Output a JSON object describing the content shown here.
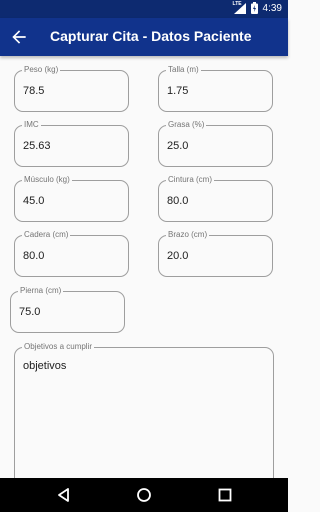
{
  "status": {
    "network": "LTE",
    "time": "4:39"
  },
  "appbar": {
    "title": "Capturar Cita - Datos Paciente",
    "back_icon": "arrow-left-icon"
  },
  "fields": {
    "peso": {
      "label": "Peso (kg)",
      "value": "78.5"
    },
    "talla": {
      "label": "Talla (m)",
      "value": "1.75"
    },
    "imc": {
      "label": "IMC",
      "value": "25.63"
    },
    "grasa": {
      "label": "Grasa (%)",
      "value": "25.0"
    },
    "musculo": {
      "label": "Músculo (kg)",
      "value": "45.0"
    },
    "cintura": {
      "label": "Cintura (cm)",
      "value": "80.0"
    },
    "cadera": {
      "label": "Cadera (cm)",
      "value": "80.0"
    },
    "brazo": {
      "label": "Brazo (cm)",
      "value": "20.0"
    },
    "pierna": {
      "label": "Pierna (cm)",
      "value": "75.0"
    }
  },
  "objetivos": {
    "label": "Objetivos a cumplir",
    "value": "objetivos"
  },
  "colors": {
    "appbar": "#11338c",
    "statusbar": "#0d2a70",
    "background": "#fafafa"
  }
}
